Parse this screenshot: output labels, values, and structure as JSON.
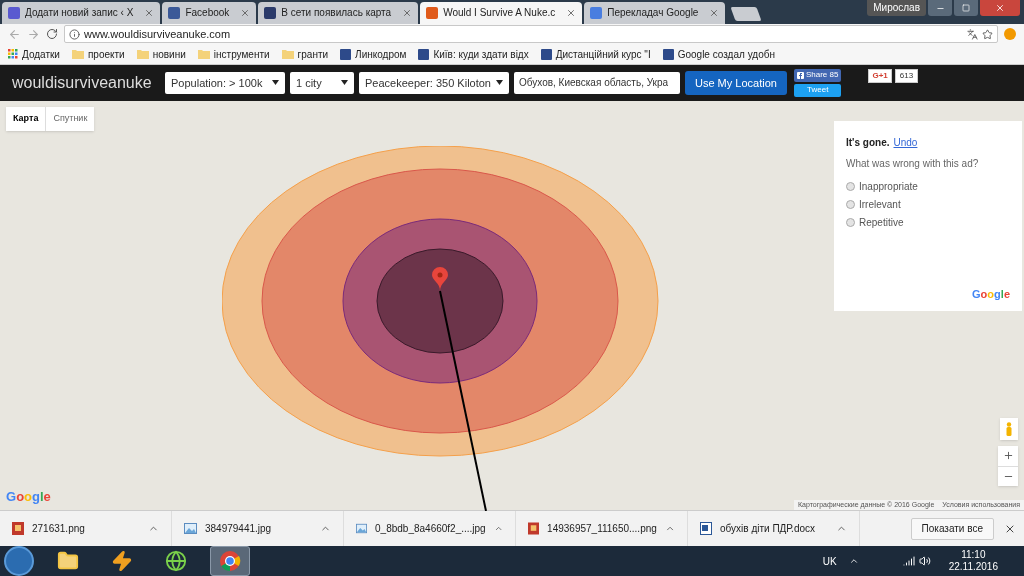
{
  "window": {
    "user": "Мирослав"
  },
  "tabs": [
    {
      "label": "Додати новий запис ‹ Х",
      "selected": false,
      "color": "#5a5ad0"
    },
    {
      "label": "Facebook",
      "selected": false,
      "color": "#3b5998"
    },
    {
      "label": "В сети появилась карта",
      "selected": false,
      "color": "#2a3a6a"
    },
    {
      "label": "Would I Survive A Nuke.c",
      "selected": true,
      "color": "#e05a1a"
    },
    {
      "label": "Перекладач Google",
      "selected": false,
      "color": "#4a7ee0"
    }
  ],
  "address_bar": {
    "url": "www.wouldisurviveanuke.com"
  },
  "bookmarks": [
    {
      "label": "Додатки",
      "kind": "apps"
    },
    {
      "label": "проекти",
      "kind": "folder"
    },
    {
      "label": "новини",
      "kind": "folder"
    },
    {
      "label": "інструменти",
      "kind": "folder"
    },
    {
      "label": "гранти",
      "kind": "folder"
    },
    {
      "label": "Линкодром",
      "kind": "site"
    },
    {
      "label": "Київ: куди здати відх",
      "kind": "site"
    },
    {
      "label": "Дистанційний курс \"І",
      "kind": "site"
    },
    {
      "label": "Google создал удобн",
      "kind": "site"
    }
  ],
  "app": {
    "logo": "wouldisurviveanuke",
    "selects": [
      {
        "value": "Population: > 100k"
      },
      {
        "value": "1 city"
      },
      {
        "value": "Peacekeeper: 350 Kiloton"
      }
    ],
    "location": {
      "value": "Обухов, Киевская область, Укра"
    },
    "locate_button": "Use My Location",
    "share": {
      "facebook": "Share",
      "facebook_count": "85",
      "tweet": "Tweet",
      "gplus": "G+1",
      "gplus_count": "613"
    }
  },
  "map": {
    "types": [
      {
        "label": "Карта",
        "selected": true
      },
      {
        "label": "Спутник",
        "selected": false
      }
    ],
    "rings": [
      {
        "color": "#f5a04a"
      },
      {
        "color": "#d9574a"
      },
      {
        "color": "#7a2a7a"
      },
      {
        "color": "#3a1a2a"
      }
    ],
    "attribution": "Картографические данные © 2016 Google",
    "terms": "Условия использования",
    "logo": "Google"
  },
  "ad_panel": {
    "gone": "It's gone.",
    "undo": "Undo",
    "question": "What was wrong with this ad?",
    "options": [
      {
        "label": "Inappropriate",
        "checked": false
      },
      {
        "label": "Irrelevant",
        "checked": false
      },
      {
        "label": "Repetitive",
        "checked": false
      }
    ],
    "brand": "Google"
  },
  "downloads": [
    {
      "name": "271631.png",
      "kind": "image"
    },
    {
      "name": "384979441.jpg",
      "kind": "photo"
    },
    {
      "name": "0_8bdb_8a4660f2_....jpg",
      "kind": "photo"
    },
    {
      "name": "14936957_111650....png",
      "kind": "image"
    },
    {
      "name": "обухів діти ПДР.docx",
      "kind": "doc"
    }
  ],
  "show_all": "Показати все",
  "taskbar": {
    "apps": [
      {
        "kind": "folder",
        "selected": false
      },
      {
        "kind": "bolt",
        "selected": false
      },
      {
        "kind": "globe",
        "selected": false
      },
      {
        "kind": "chrome",
        "selected": true
      }
    ],
    "language": "UK",
    "time": "11:10",
    "date": "22.11.2016"
  }
}
